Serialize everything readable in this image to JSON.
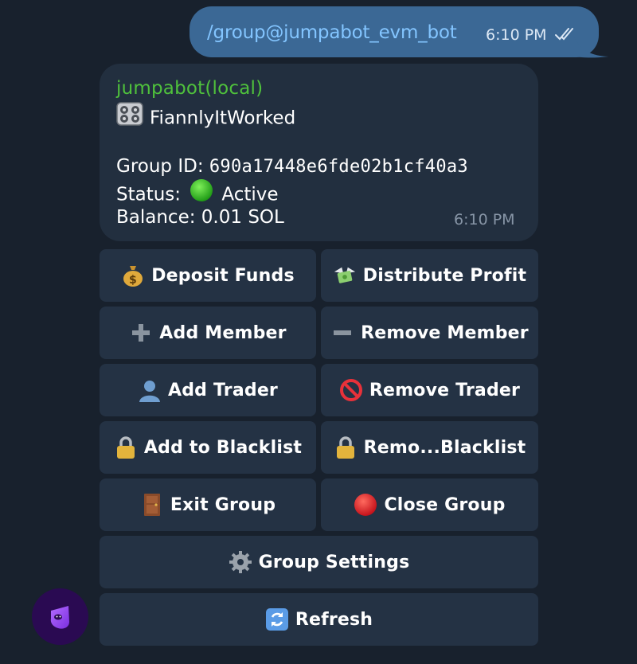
{
  "outgoing": {
    "text": "/group@jumpabot_evm_bot",
    "time": "6:10 PM",
    "status_icon": "double-check-icon"
  },
  "message": {
    "sender": "jumpabot(local)",
    "group_name": "FiannlyItWorked",
    "group_id_label": "Group ID:",
    "group_id": "690a17448e6fde02b1cf40a3",
    "status_label": "Status:",
    "status_value": "Active",
    "balance_label": "Balance:",
    "balance_value": "0.01 SOL",
    "time": "6:10 PM"
  },
  "keyboard": {
    "deposit": "Deposit Funds",
    "distribute": "Distribute Profit",
    "add_member": "Add Member",
    "remove_member": "Remove Member",
    "add_trader": "Add Trader",
    "remove_trader": "Remove Trader",
    "add_blacklist": "Add to Blacklist",
    "remove_blacklist": "Remo...Blacklist",
    "exit_group": "Exit Group",
    "close_group": "Close Group",
    "group_settings": "Group Settings",
    "refresh": "Refresh"
  },
  "colors": {
    "background": "#18212d",
    "outgoing_bubble": "#3b6895",
    "incoming_bubble": "#222f3f",
    "button": "#243244",
    "sender_name": "#4fc13c",
    "command_link": "#83c5ff"
  }
}
